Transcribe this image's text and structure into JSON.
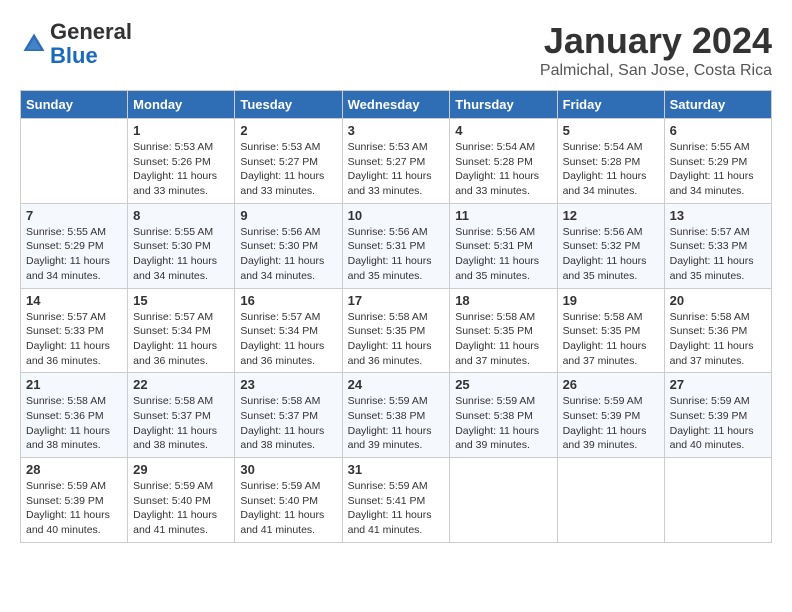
{
  "header": {
    "logo_general": "General",
    "logo_blue": "Blue",
    "month_title": "January 2024",
    "location": "Palmichal, San Jose, Costa Rica"
  },
  "weekdays": [
    "Sunday",
    "Monday",
    "Tuesday",
    "Wednesday",
    "Thursday",
    "Friday",
    "Saturday"
  ],
  "weeks": [
    [
      {
        "day": "",
        "sunrise": "",
        "sunset": "",
        "daylight": ""
      },
      {
        "day": "1",
        "sunrise": "Sunrise: 5:53 AM",
        "sunset": "Sunset: 5:26 PM",
        "daylight": "Daylight: 11 hours and 33 minutes."
      },
      {
        "day": "2",
        "sunrise": "Sunrise: 5:53 AM",
        "sunset": "Sunset: 5:27 PM",
        "daylight": "Daylight: 11 hours and 33 minutes."
      },
      {
        "day": "3",
        "sunrise": "Sunrise: 5:53 AM",
        "sunset": "Sunset: 5:27 PM",
        "daylight": "Daylight: 11 hours and 33 minutes."
      },
      {
        "day": "4",
        "sunrise": "Sunrise: 5:54 AM",
        "sunset": "Sunset: 5:28 PM",
        "daylight": "Daylight: 11 hours and 33 minutes."
      },
      {
        "day": "5",
        "sunrise": "Sunrise: 5:54 AM",
        "sunset": "Sunset: 5:28 PM",
        "daylight": "Daylight: 11 hours and 34 minutes."
      },
      {
        "day": "6",
        "sunrise": "Sunrise: 5:55 AM",
        "sunset": "Sunset: 5:29 PM",
        "daylight": "Daylight: 11 hours and 34 minutes."
      }
    ],
    [
      {
        "day": "7",
        "sunrise": "Sunrise: 5:55 AM",
        "sunset": "Sunset: 5:29 PM",
        "daylight": "Daylight: 11 hours and 34 minutes."
      },
      {
        "day": "8",
        "sunrise": "Sunrise: 5:55 AM",
        "sunset": "Sunset: 5:30 PM",
        "daylight": "Daylight: 11 hours and 34 minutes."
      },
      {
        "day": "9",
        "sunrise": "Sunrise: 5:56 AM",
        "sunset": "Sunset: 5:30 PM",
        "daylight": "Daylight: 11 hours and 34 minutes."
      },
      {
        "day": "10",
        "sunrise": "Sunrise: 5:56 AM",
        "sunset": "Sunset: 5:31 PM",
        "daylight": "Daylight: 11 hours and 35 minutes."
      },
      {
        "day": "11",
        "sunrise": "Sunrise: 5:56 AM",
        "sunset": "Sunset: 5:31 PM",
        "daylight": "Daylight: 11 hours and 35 minutes."
      },
      {
        "day": "12",
        "sunrise": "Sunrise: 5:56 AM",
        "sunset": "Sunset: 5:32 PM",
        "daylight": "Daylight: 11 hours and 35 minutes."
      },
      {
        "day": "13",
        "sunrise": "Sunrise: 5:57 AM",
        "sunset": "Sunset: 5:33 PM",
        "daylight": "Daylight: 11 hours and 35 minutes."
      }
    ],
    [
      {
        "day": "14",
        "sunrise": "Sunrise: 5:57 AM",
        "sunset": "Sunset: 5:33 PM",
        "daylight": "Daylight: 11 hours and 36 minutes."
      },
      {
        "day": "15",
        "sunrise": "Sunrise: 5:57 AM",
        "sunset": "Sunset: 5:34 PM",
        "daylight": "Daylight: 11 hours and 36 minutes."
      },
      {
        "day": "16",
        "sunrise": "Sunrise: 5:57 AM",
        "sunset": "Sunset: 5:34 PM",
        "daylight": "Daylight: 11 hours and 36 minutes."
      },
      {
        "day": "17",
        "sunrise": "Sunrise: 5:58 AM",
        "sunset": "Sunset: 5:35 PM",
        "daylight": "Daylight: 11 hours and 36 minutes."
      },
      {
        "day": "18",
        "sunrise": "Sunrise: 5:58 AM",
        "sunset": "Sunset: 5:35 PM",
        "daylight": "Daylight: 11 hours and 37 minutes."
      },
      {
        "day": "19",
        "sunrise": "Sunrise: 5:58 AM",
        "sunset": "Sunset: 5:35 PM",
        "daylight": "Daylight: 11 hours and 37 minutes."
      },
      {
        "day": "20",
        "sunrise": "Sunrise: 5:58 AM",
        "sunset": "Sunset: 5:36 PM",
        "daylight": "Daylight: 11 hours and 37 minutes."
      }
    ],
    [
      {
        "day": "21",
        "sunrise": "Sunrise: 5:58 AM",
        "sunset": "Sunset: 5:36 PM",
        "daylight": "Daylight: 11 hours and 38 minutes."
      },
      {
        "day": "22",
        "sunrise": "Sunrise: 5:58 AM",
        "sunset": "Sunset: 5:37 PM",
        "daylight": "Daylight: 11 hours and 38 minutes."
      },
      {
        "day": "23",
        "sunrise": "Sunrise: 5:58 AM",
        "sunset": "Sunset: 5:37 PM",
        "daylight": "Daylight: 11 hours and 38 minutes."
      },
      {
        "day": "24",
        "sunrise": "Sunrise: 5:59 AM",
        "sunset": "Sunset: 5:38 PM",
        "daylight": "Daylight: 11 hours and 39 minutes."
      },
      {
        "day": "25",
        "sunrise": "Sunrise: 5:59 AM",
        "sunset": "Sunset: 5:38 PM",
        "daylight": "Daylight: 11 hours and 39 minutes."
      },
      {
        "day": "26",
        "sunrise": "Sunrise: 5:59 AM",
        "sunset": "Sunset: 5:39 PM",
        "daylight": "Daylight: 11 hours and 39 minutes."
      },
      {
        "day": "27",
        "sunrise": "Sunrise: 5:59 AM",
        "sunset": "Sunset: 5:39 PM",
        "daylight": "Daylight: 11 hours and 40 minutes."
      }
    ],
    [
      {
        "day": "28",
        "sunrise": "Sunrise: 5:59 AM",
        "sunset": "Sunset: 5:39 PM",
        "daylight": "Daylight: 11 hours and 40 minutes."
      },
      {
        "day": "29",
        "sunrise": "Sunrise: 5:59 AM",
        "sunset": "Sunset: 5:40 PM",
        "daylight": "Daylight: 11 hours and 41 minutes."
      },
      {
        "day": "30",
        "sunrise": "Sunrise: 5:59 AM",
        "sunset": "Sunset: 5:40 PM",
        "daylight": "Daylight: 11 hours and 41 minutes."
      },
      {
        "day": "31",
        "sunrise": "Sunrise: 5:59 AM",
        "sunset": "Sunset: 5:41 PM",
        "daylight": "Daylight: 11 hours and 41 minutes."
      },
      {
        "day": "",
        "sunrise": "",
        "sunset": "",
        "daylight": ""
      },
      {
        "day": "",
        "sunrise": "",
        "sunset": "",
        "daylight": ""
      },
      {
        "day": "",
        "sunrise": "",
        "sunset": "",
        "daylight": ""
      }
    ]
  ]
}
